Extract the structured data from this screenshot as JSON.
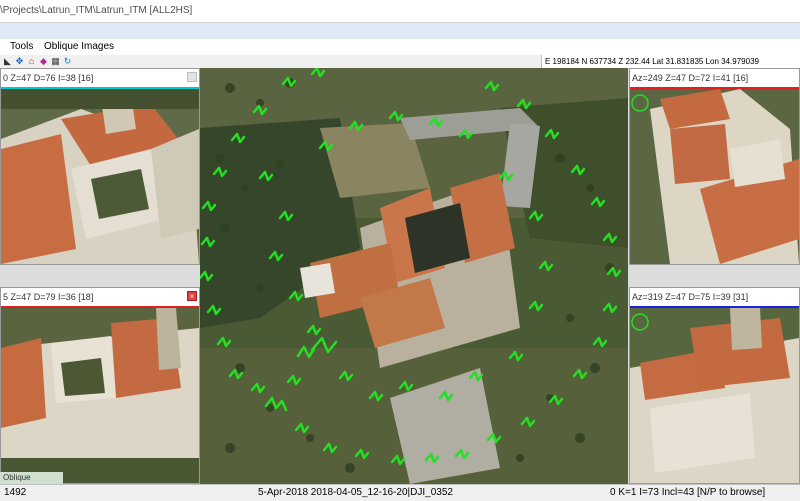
{
  "window": {
    "title": "\\Projects\\Latrun_ITM\\Latrun_ITM [ALL2HS]"
  },
  "menu": {
    "items": [
      "Tools",
      "Oblique Images"
    ]
  },
  "toolbar": {
    "coordinates": "E 198184 N 637734 Z 232.44 Lat 31.831835 Lon 34.979039"
  },
  "panels": {
    "top_left": {
      "title": "0 Z=47 D=76 I=38 [16]",
      "accent": "#00c8c8"
    },
    "mid_left": {
      "title": "5 Z=47 D=79 I=36 [18]",
      "accent": "#e02020"
    },
    "top_right": {
      "title": "Az=249 Z=47 D=72 I=41 [16]",
      "accent": "#e02020"
    },
    "bottom_right": {
      "title": "Az=319 Z=47 D=75 I=39 [31]",
      "accent": "#2020e0"
    },
    "bottom_left_label": "Oblique"
  },
  "status": {
    "left": "1492",
    "center": "5-Apr-2018 2018-04-05_12-16-20|DJI_0352",
    "right": "0 K=1 I=73 Incl=43  [N/P to browse]"
  },
  "colors": {
    "marker": "#22e022",
    "accent_cyan": "#00c8c8",
    "accent_red": "#e02020",
    "accent_blue": "#2020e0"
  }
}
